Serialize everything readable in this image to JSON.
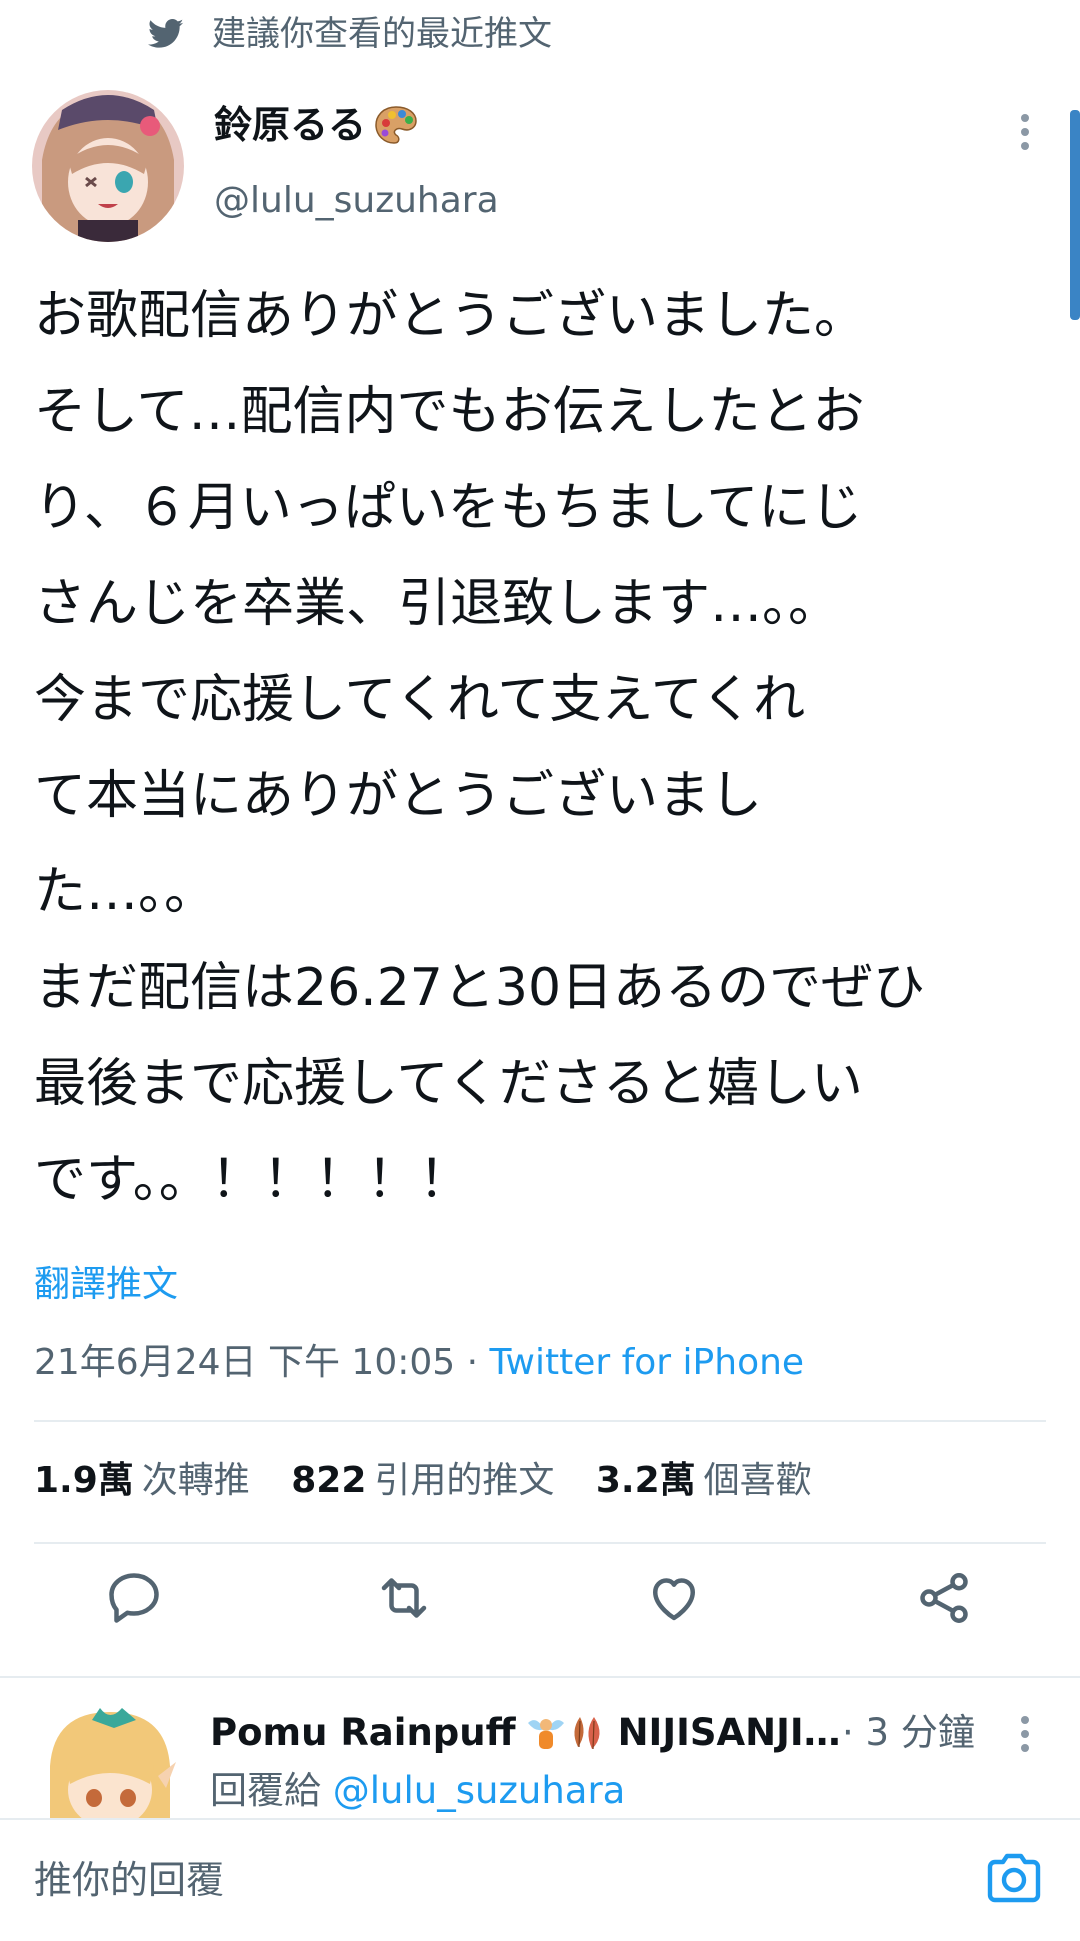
{
  "suggestion": {
    "text": "建議你查看的最近推文",
    "icon": "twitter-bird-icon"
  },
  "tweet": {
    "author_name": "鈴原るる",
    "author_emoji": "palette-icon",
    "author_handle": "@lulu_suzuhara",
    "body_lines": [
      "お歌配信ありがとうございました。",
      "そして…配信内でもお伝えしたとお",
      "り、６月いっぱいをもちましてにじ",
      "さんじを卒業、引退致します…。。",
      "今まで応援してくれて支えてくれ",
      "て本当にありがとうございまし",
      "た…。。",
      "まだ配信は26.27と30日あるのでぜひ",
      "最後まで応援してくださると嬉しい",
      "です。。！！！！！"
    ],
    "translate_label": "翻譯推文",
    "timestamp": "21年6月24日 下午 10:05 · ",
    "source": "Twitter for iPhone"
  },
  "stats": {
    "retweets_count": "1.9萬",
    "retweets_label": "次轉推",
    "quotes_count": "822",
    "quotes_label": "引用的推文",
    "likes_count": "3.2萬",
    "likes_label": "個喜歡"
  },
  "actions": [
    "reply-icon",
    "retweet-icon",
    "like-icon",
    "share-icon"
  ],
  "reply": {
    "author_name": "Pomu Rainpuff",
    "author_name_suffix": "NIJISANJI…",
    "time": "· 3 分鐘",
    "reply_to_label": "回覆給",
    "reply_to_handle": "@lulu_suzuhara"
  },
  "composer": {
    "placeholder": "推你的回覆",
    "camera_icon": "camera-icon"
  },
  "colors": {
    "accent": "#1d9bf0",
    "secondary_text": "#536471",
    "text": "#0f1419",
    "divider": "#e6ecf0"
  }
}
